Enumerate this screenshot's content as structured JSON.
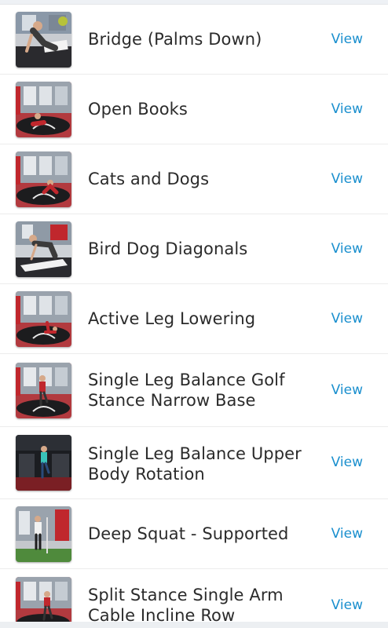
{
  "exercises": [
    {
      "title": "Bridge (Palms Down)",
      "view_label": "View",
      "thumb": "bridge-scene"
    },
    {
      "title": "Open Books",
      "view_label": "View",
      "thumb": "studio-floor-scene"
    },
    {
      "title": "Cats and Dogs",
      "view_label": "View",
      "thumb": "studio-floor-scene"
    },
    {
      "title": "Bird Dog Diagonals",
      "view_label": "View",
      "thumb": "bird-dog-scene"
    },
    {
      "title": "Active Leg Lowering",
      "view_label": "View",
      "thumb": "studio-floor-scene"
    },
    {
      "title": "Single Leg Balance Golf Stance Narrow Base",
      "view_label": "View",
      "thumb": "studio-standing-scene"
    },
    {
      "title": "Single Leg Balance Upper Body Rotation",
      "view_label": "View",
      "thumb": "gym-standing-scene"
    },
    {
      "title": "Deep Squat - Supported",
      "view_label": "View",
      "thumb": "gym-squat-scene"
    },
    {
      "title": "Split Stance Single Arm Cable Incline Row",
      "view_label": "View",
      "thumb": "studio-standing-scene"
    }
  ],
  "colors": {
    "link": "#1a8fce",
    "text": "#2b2b2b",
    "divider": "#ececec"
  }
}
